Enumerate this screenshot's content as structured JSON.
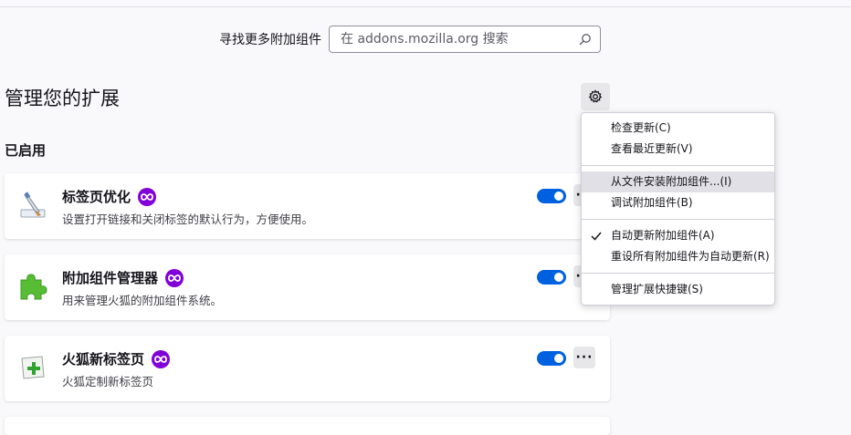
{
  "search": {
    "label": "寻找更多附加组件",
    "placeholder": "在 addons.mozilla.org 搜索"
  },
  "page": {
    "title": "管理您的扩展",
    "section_enabled": "已启用"
  },
  "extensions": [
    {
      "name": "标签页优化",
      "description": "设置打开链接和关闭标签的默认行为，方便使用。",
      "enabled": true,
      "icon": "brush-window-icon"
    },
    {
      "name": "附加组件管理器",
      "description": "用来管理火狐的附加组件系统。",
      "enabled": true,
      "icon": "puzzle-piece-icon"
    },
    {
      "name": "火狐新标签页",
      "description": "火狐定制新标签页",
      "enabled": true,
      "icon": "new-tab-plus-icon"
    }
  ],
  "menu": {
    "items": [
      {
        "label": "检查更新(C)"
      },
      {
        "label": "查看最近更新(V)"
      },
      {
        "label": "从文件安装附加组件...(I)"
      },
      {
        "label": "调试附加组件(B)"
      },
      {
        "label": "自动更新附加组件(A)",
        "checked": true
      },
      {
        "label": "重设所有附加组件为自动更新(R)"
      },
      {
        "label": "管理扩展快捷键(S)"
      }
    ]
  },
  "colors": {
    "accent": "#0061e0",
    "badge": "#8000d7",
    "background": "#f9f9fb"
  }
}
